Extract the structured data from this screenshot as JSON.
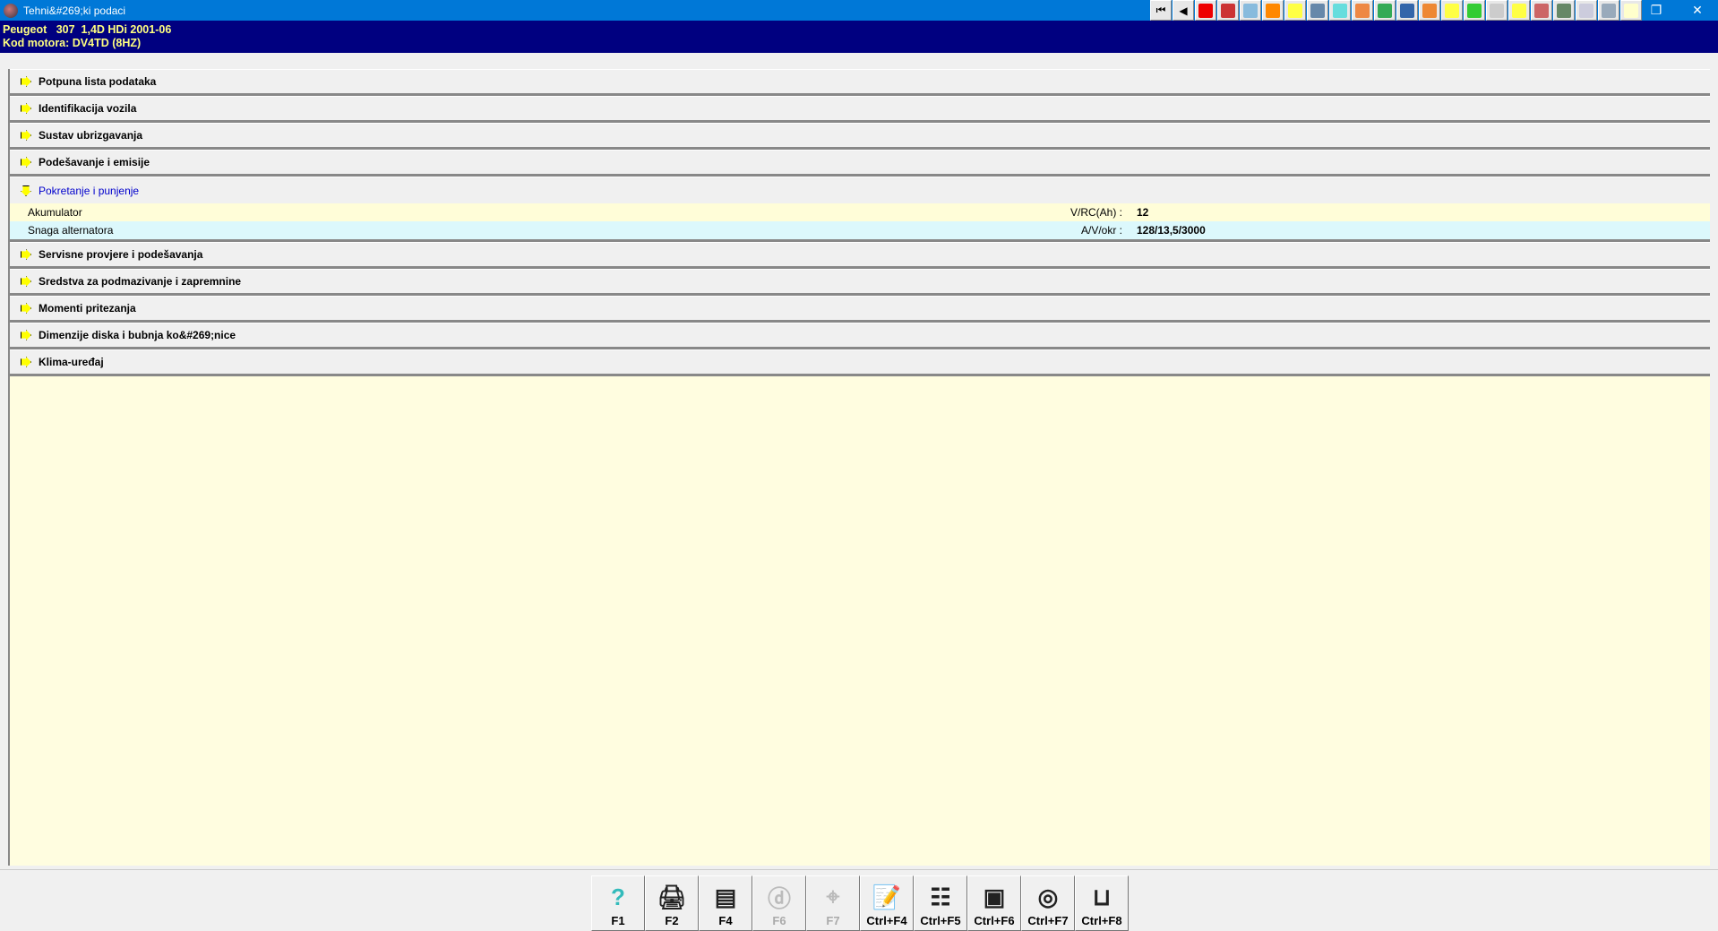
{
  "window": {
    "title": "Tehni&#269;ki podaci"
  },
  "header": {
    "vehicle": "Peugeot   307  1,4D HDi 2001-06",
    "engine": "Kod motora: DV4TD (8HZ)"
  },
  "sections": [
    {
      "label": "Potpuna lista podataka"
    },
    {
      "label": "Identifikacija vozila"
    },
    {
      "label": "Sustav ubrizgavanja"
    },
    {
      "label": "Podešavanje i emisije"
    },
    {
      "label": "Pokretanje i punjenje",
      "rows": [
        {
          "name": "Akumulator",
          "unit": "V/RC(Ah) :",
          "value": "12",
          "color": "#fffdd8"
        },
        {
          "name": "Snaga alternatora",
          "unit": "A/V/okr :",
          "value": "128/13,5/3000",
          "color": "#dcf8fc"
        }
      ]
    },
    {
      "label": "Servisne provjere i podešavanja"
    },
    {
      "label": "Sredstva za podmazivanje i zapremnine"
    },
    {
      "label": "Momenti pritezanja"
    },
    {
      "label": "Dimenzije diska i bubnja ko&#269;nice"
    },
    {
      "label": "Klima-uređaj"
    }
  ],
  "fkeys": [
    {
      "label": "F1",
      "icon": "?",
      "enabled": true
    },
    {
      "label": "F2",
      "icon": "🖨",
      "enabled": true
    },
    {
      "label": "F4",
      "icon": "▤",
      "enabled": true
    },
    {
      "label": "F6",
      "icon": "ⓓ",
      "enabled": false
    },
    {
      "label": "F7",
      "icon": "⌖",
      "enabled": false
    },
    {
      "label": "Ctrl+F4",
      "icon": "📝",
      "enabled": true
    },
    {
      "label": "Ctrl+F5",
      "icon": "☷",
      "enabled": true
    },
    {
      "label": "Ctrl+F6",
      "icon": "▣",
      "enabled": true
    },
    {
      "label": "Ctrl+F7",
      "icon": "◎",
      "enabled": true
    },
    {
      "label": "Ctrl+F8",
      "icon": "⊔",
      "enabled": true
    }
  ],
  "toolbar_colors": [
    "#e00",
    "#c33",
    "#8bd",
    "#f80",
    "#ff4",
    "#68a",
    "#6dd",
    "#e84",
    "#3a5",
    "#36a",
    "#e83",
    "#ff4",
    "#3c3",
    "#ccc",
    "#ff4",
    "#c66",
    "#686",
    "#ccd",
    "#9ab",
    "#ffc"
  ]
}
